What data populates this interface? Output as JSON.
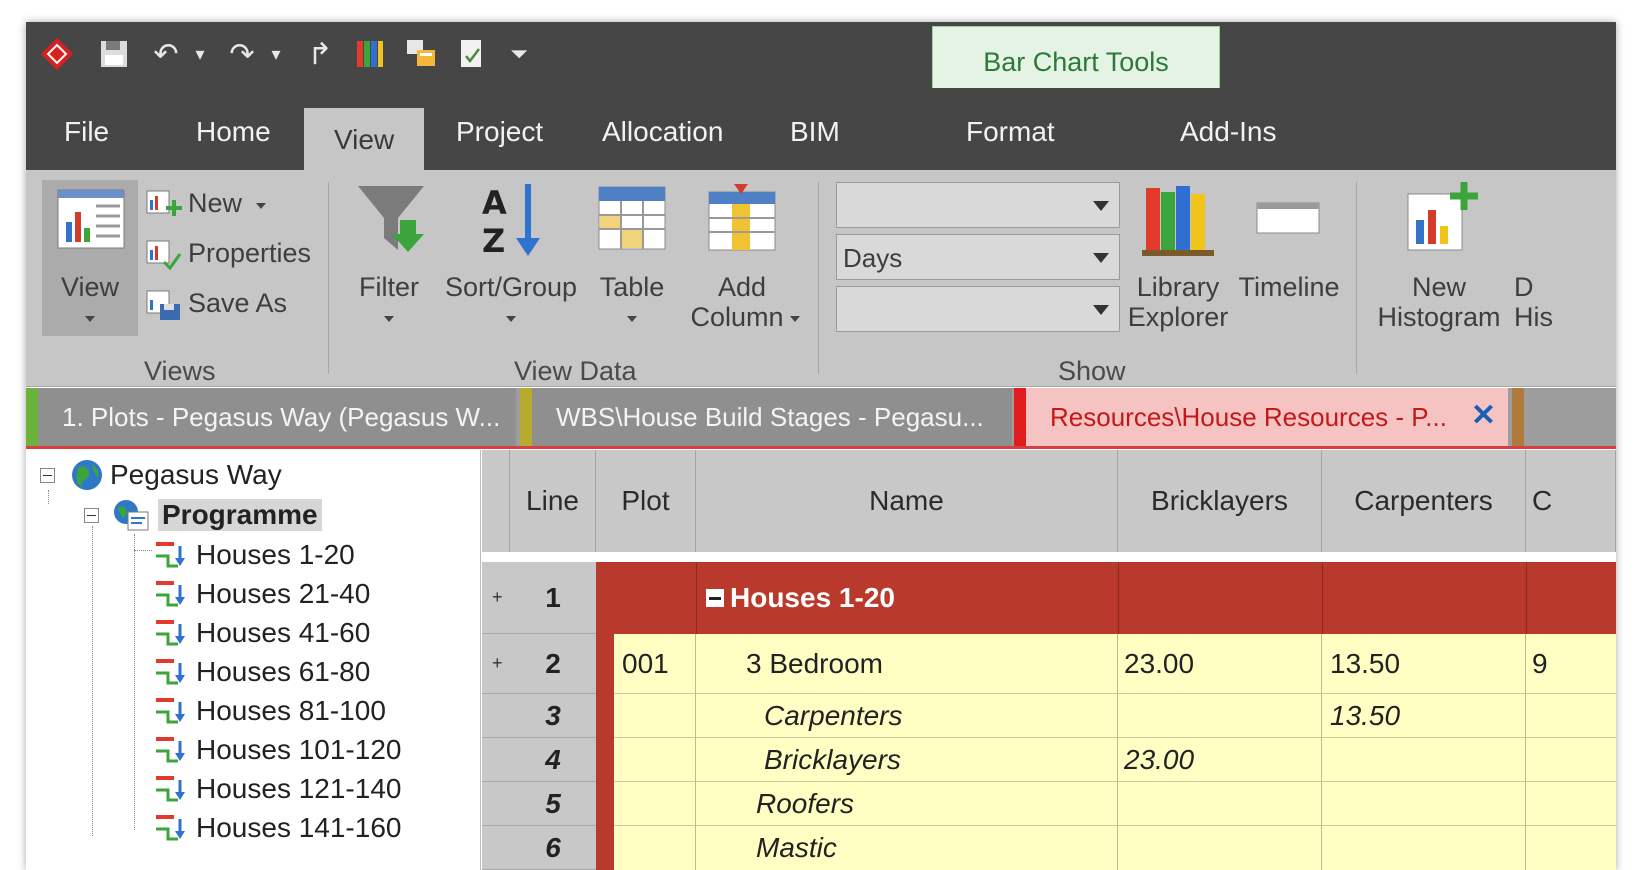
{
  "app": {
    "context_tab": "Bar Chart Tools",
    "tabs": [
      "File",
      "Home",
      "View",
      "Project",
      "Allocation",
      "BIM",
      "Format",
      "Add-Ins"
    ],
    "active_tab": "View"
  },
  "ribbon": {
    "views": {
      "view_label": "View",
      "new_label": "New",
      "properties_label": "Properties",
      "save_as_label": "Save As",
      "group_label": "Views"
    },
    "view_data": {
      "filter_label": "Filter",
      "sort_group_label": "Sort/Group",
      "table_label": "Table",
      "add_line1": "Add",
      "add_line2": "Column",
      "group_label": "View Data"
    },
    "show": {
      "combo1_value": "",
      "combo2_value": "Days",
      "combo3_value": "",
      "library_line1": "Library",
      "library_line2": "Explorer",
      "timeline_label": "Timeline",
      "group_label": "Show"
    },
    "histogram": {
      "new_line1": "New",
      "new_line2": "Histogram",
      "partial_line1": "D",
      "partial_line2": "His"
    }
  },
  "doc_tabs": [
    {
      "label": "1. Plots - Pegasus Way (Pegasus W...",
      "color": "#6bb33a"
    },
    {
      "label": "WBS\\House Build Stages - Pegasu...",
      "color": "#b7ab2e"
    },
    {
      "label": "Resources\\House Resources - P...",
      "color": "#e01c1c",
      "close": "✕"
    }
  ],
  "tree": {
    "root": "Pegasus Way",
    "programme": "Programme",
    "children": [
      "Houses 1-20",
      "Houses 21-40",
      "Houses 41-60",
      "Houses 61-80",
      "Houses 81-100",
      "Houses 101-120",
      "Houses 121-140",
      "Houses 141-160"
    ]
  },
  "grid": {
    "headers": {
      "line": "Line",
      "plot": "Plot",
      "name": "Name",
      "bricklayers": "Bricklayers",
      "carpenters": "Carpenters",
      "partial": "C"
    },
    "rows": [
      {
        "line": "1",
        "plot": "",
        "name": "Houses 1-20",
        "bricklayers": "",
        "carpenters": "",
        "extra": "",
        "expander": "+"
      },
      {
        "line": "2",
        "plot": "001",
        "name": "3 Bedroom",
        "bricklayers": "23.00",
        "carpenters": "13.50",
        "extra": "9",
        "expander": "+"
      },
      {
        "line": "3",
        "plot": "",
        "name": "Carpenters",
        "bricklayers": "",
        "carpenters": "13.50",
        "extra": ""
      },
      {
        "line": "4",
        "plot": "",
        "name": "Bricklayers",
        "bricklayers": "23.00",
        "carpenters": "",
        "extra": ""
      },
      {
        "line": "5",
        "plot": "",
        "name": "Roofers",
        "bricklayers": "",
        "carpenters": "",
        "extra": ""
      },
      {
        "line": "6",
        "plot": "",
        "name": "Mastic",
        "bricklayers": "",
        "carpenters": "",
        "extra": ""
      }
    ]
  }
}
